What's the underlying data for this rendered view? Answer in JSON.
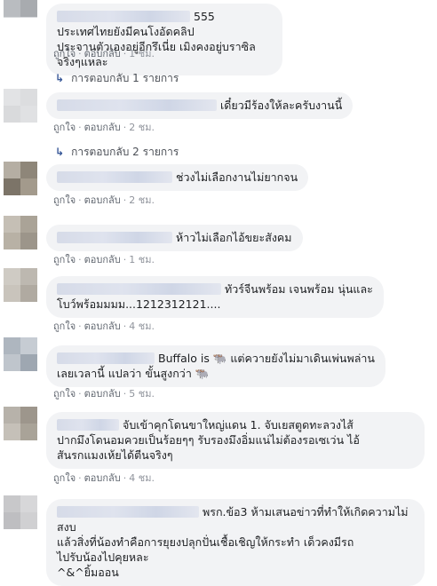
{
  "actions": {
    "like": "ถูกใจ",
    "reply": "ตอบกลับ",
    "dot": "·"
  },
  "reply_arrow": "↳",
  "comments": [
    {
      "text": "555 ประเทศไทยยังมีคนโงอัดคลิป\nประจานตัวเองอยู่อีกรึเนี่ย เมิงคงอยู่บราซิลจริงๆแหละ",
      "time": "1 ชม.",
      "replies": "การตอบกลับ 1 รายการ"
    },
    {
      "text": "เดี๋ยวมีร้องให้ละครับงานนี้",
      "time": "2 ชม.",
      "replies": "การตอบกลับ 2 รายการ"
    },
    {
      "text": "ช่วงไม่เลือกงานไม่ยากจน",
      "time": "2 ชม."
    },
    {
      "text": "ห้าวไม่เลือกไอ้ขยะสังคม",
      "time": "1 ชม."
    },
    {
      "text": "ทัวร์จีนพร้อม เจนพร้อม นุ่นและ\nโบว์พร้อมมมม...1212312121....",
      "time": "4 ชม."
    },
    {
      "text": "Buffalo is 🐃 แต่ควายยังไม่มาเดินเพ่นพล่าน\nเลยเวลานี้ แปลว่า ขั้นสูงกว่า 🐃",
      "time": "5 ชม."
    },
    {
      "text": "จับเข้าคุกโดนขาใหญ่แดน 1. จับเยสตูดทะลวงไส้\nปากมึงโดนอมควยเป็นร้อยๆๆ รับรองมึงอิ่มแน่ไม่ต้องรอเซเว่น ไอ้\nสันรกแมงเห้ยได้ตีนจริงๆ",
      "time": "4 ชม."
    },
    {
      "text": "พรก.ข้อ3 ห้ามเสนอข่าวที่ทำให้เกิดความไม่สงบ\nแล้วสิ่งที่น้องทำคือการยุยงปลุกปั่นเชื้อเชิญให้กระทำ เด็วคงมีรถ\nไปรับน้องไปคุยหละ\n^&^ยิ้มออน",
      "time": ""
    }
  ]
}
